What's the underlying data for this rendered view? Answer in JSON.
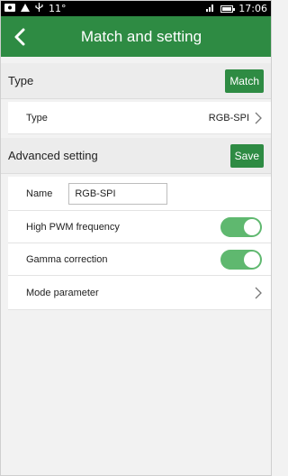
{
  "statusbar": {
    "left_icons": [
      "photo-icon",
      "warning-icon",
      "usb-icon"
    ],
    "temperature": "11°",
    "signal_glyph": "signal-icon",
    "time": "17:06"
  },
  "appbar": {
    "title": "Match and setting"
  },
  "type_section": {
    "title": "Type",
    "button_label": "Match",
    "row": {
      "label": "Type",
      "value": "RGB-SPI"
    }
  },
  "advanced_section": {
    "title": "Advanced setting",
    "button_label": "Save",
    "name_row": {
      "label": "Name",
      "value": "RGB-SPI"
    },
    "pwm_row": {
      "label": "High PWM frequency",
      "enabled": true
    },
    "gamma_row": {
      "label": "Gamma correction",
      "enabled": true
    },
    "mode_row": {
      "label": "Mode parameter"
    }
  },
  "colors": {
    "accent": "#2e8b43",
    "toggle_on": "#5fb86f",
    "background": "#f2f2f2"
  }
}
